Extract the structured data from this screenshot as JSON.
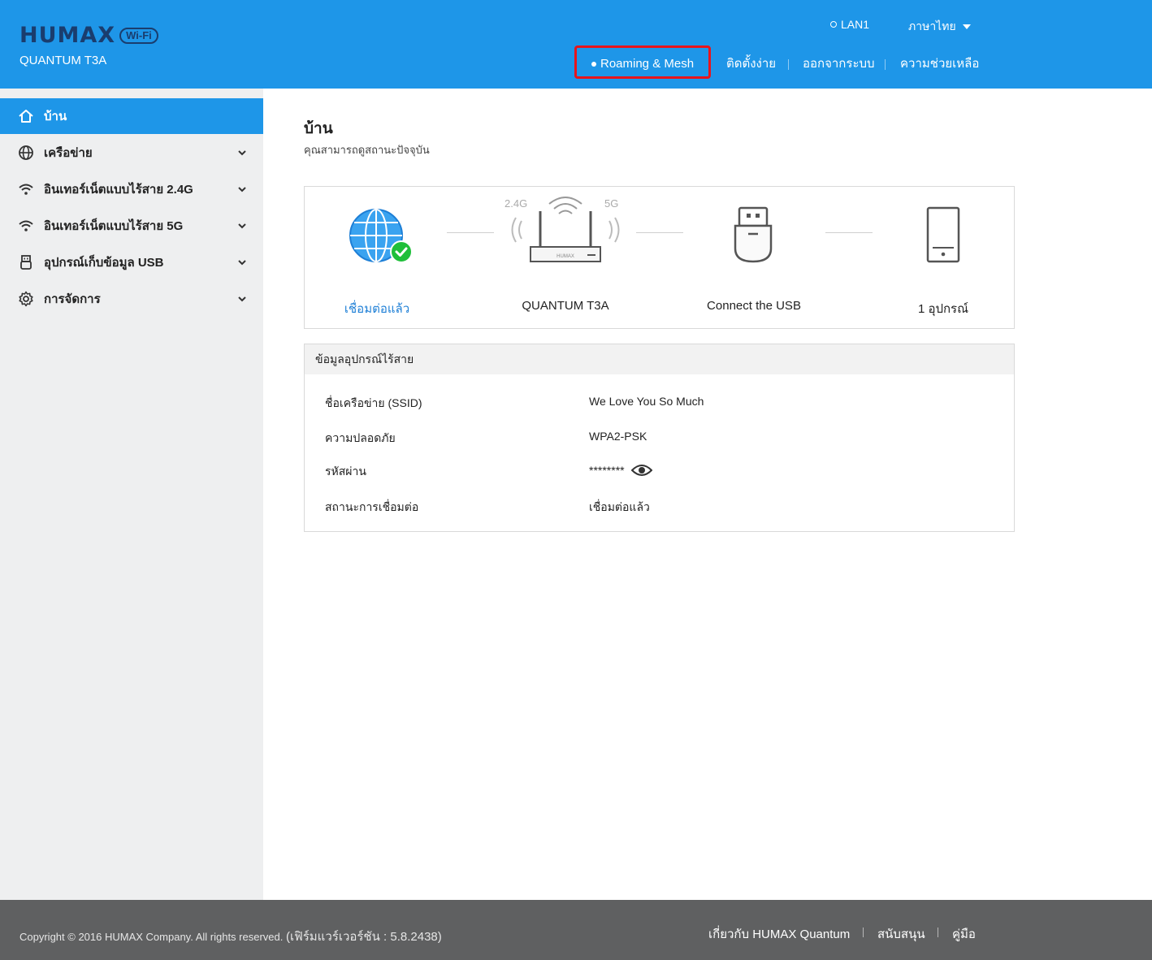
{
  "header": {
    "logo_text": "HUMAX",
    "logo_badge": "Wi-Fi",
    "model": "QUANTUM T3A",
    "lan_label": "LAN1",
    "language": "ภาษาไทย",
    "nav": {
      "roaming": "Roaming & Mesh",
      "setup": "ติดตั้งง่าย",
      "logout": "ออกจากระบบ",
      "help": "ความช่วยเหลือ"
    }
  },
  "sidebar": {
    "items": [
      {
        "label": "บ้าน",
        "icon": "home-icon",
        "active": true
      },
      {
        "label": "เครือข่าย",
        "icon": "globe-icon"
      },
      {
        "label": "อินเทอร์เน็ตแบบไร้สาย 2.4G",
        "icon": "wifi-icon"
      },
      {
        "label": "อินเทอร์เน็ตแบบไร้สาย 5G",
        "icon": "wifi-icon"
      },
      {
        "label": "อุปกรณ์เก็บข้อมูล USB",
        "icon": "usb-icon"
      },
      {
        "label": "การจัดการ",
        "icon": "gear-icon"
      }
    ]
  },
  "main": {
    "title": "บ้าน",
    "subtitle": "คุณสามารถดูสถานะปัจจุบัน",
    "status": {
      "internet_label": "เชื่อมต่อแล้ว",
      "router_label": "QUANTUM T3A",
      "router_brand": "HUMAX",
      "band_24": "2.4G",
      "band_5": "5G",
      "usb_label": "Connect the USB",
      "devices_label": "1 อุปกรณ์"
    },
    "wireless_info": {
      "heading": "ข้อมูลอุปกรณ์ไร้สาย",
      "rows": [
        {
          "key": "ชื่อเครือข่าย (SSID)",
          "value": "We Love You So Much"
        },
        {
          "key": "ความปลอดภัย",
          "value": "WPA2-PSK"
        },
        {
          "key": "รหัสผ่าน",
          "value": "********"
        },
        {
          "key": "สถานะการเชื่อมต่อ",
          "value": "เชื่อมต่อแล้ว"
        }
      ]
    }
  },
  "footer": {
    "copyright": "Copyright © 2016 HUMAX Company. All rights reserved.",
    "firmware": "(เฟิร์มแวร์เวอร์ชัน : 5.8.2438)",
    "links": {
      "about": "เกี่ยวกับ HUMAX Quantum",
      "support": "สนับสนุน",
      "manual": "คู่มือ"
    }
  },
  "colors": {
    "brand_blue": "#1e96e8",
    "highlight_red": "#e8141c",
    "connected_green": "#1fbf3a",
    "footer_gray": "#5f6061"
  }
}
